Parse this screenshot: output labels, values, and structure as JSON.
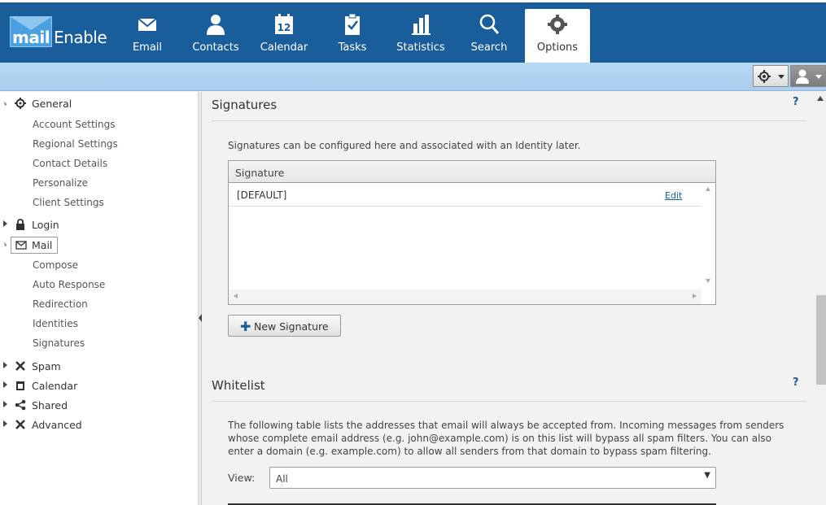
{
  "app": {
    "logo_text_bold": "mail",
    "logo_text": "Enable"
  },
  "nav": [
    {
      "label": "Email",
      "icon": "envelope-icon"
    },
    {
      "label": "Contacts",
      "icon": "person-icon"
    },
    {
      "label": "Calendar",
      "icon": "calendar-icon",
      "day": "12"
    },
    {
      "label": "Tasks",
      "icon": "clipboard-check-icon"
    },
    {
      "label": "Statistics",
      "icon": "bar-chart-icon"
    },
    {
      "label": "Search",
      "icon": "magnifier-icon"
    },
    {
      "label": "Options",
      "icon": "gear-icon",
      "active": true
    }
  ],
  "sidebar": {
    "general": {
      "label": "General",
      "items": [
        "Account Settings",
        "Regional Settings",
        "Contact Details",
        "Personalize",
        "Client Settings"
      ]
    },
    "login": {
      "label": "Login"
    },
    "mail": {
      "label": "Mail",
      "items": [
        "Compose",
        "Auto Response",
        "Redirection",
        "Identities",
        "Signatures"
      ]
    },
    "spam": {
      "label": "Spam"
    },
    "calendar": {
      "label": "Calendar"
    },
    "shared": {
      "label": "Shared"
    },
    "advanced": {
      "label": "Advanced"
    }
  },
  "signatures": {
    "heading": "Signatures",
    "help": "?",
    "description": "Signatures can be configured here and associated with an Identity later.",
    "table": {
      "column": "Signature",
      "rows": [
        {
          "name": "[DEFAULT]",
          "action": "Edit"
        }
      ]
    },
    "new_button": "New Signature"
  },
  "whitelist": {
    "heading": "Whitelist",
    "help": "?",
    "description_lines": [
      "The following table lists the addresses that email will always be accepted from. Incoming messages from senders",
      "whose complete email address (e.g. john@example.com) is on this list will bypass all spam filters. You can also",
      "enter a domain (e.g. example.com) to allow all senders from that domain to bypass spam filtering."
    ],
    "view_label": "View:",
    "view_value": "All"
  },
  "colors": {
    "header_blue": "#1a5d9b",
    "subbar_blue": "#b9d9f2",
    "link_blue": "#1a5d9b"
  }
}
